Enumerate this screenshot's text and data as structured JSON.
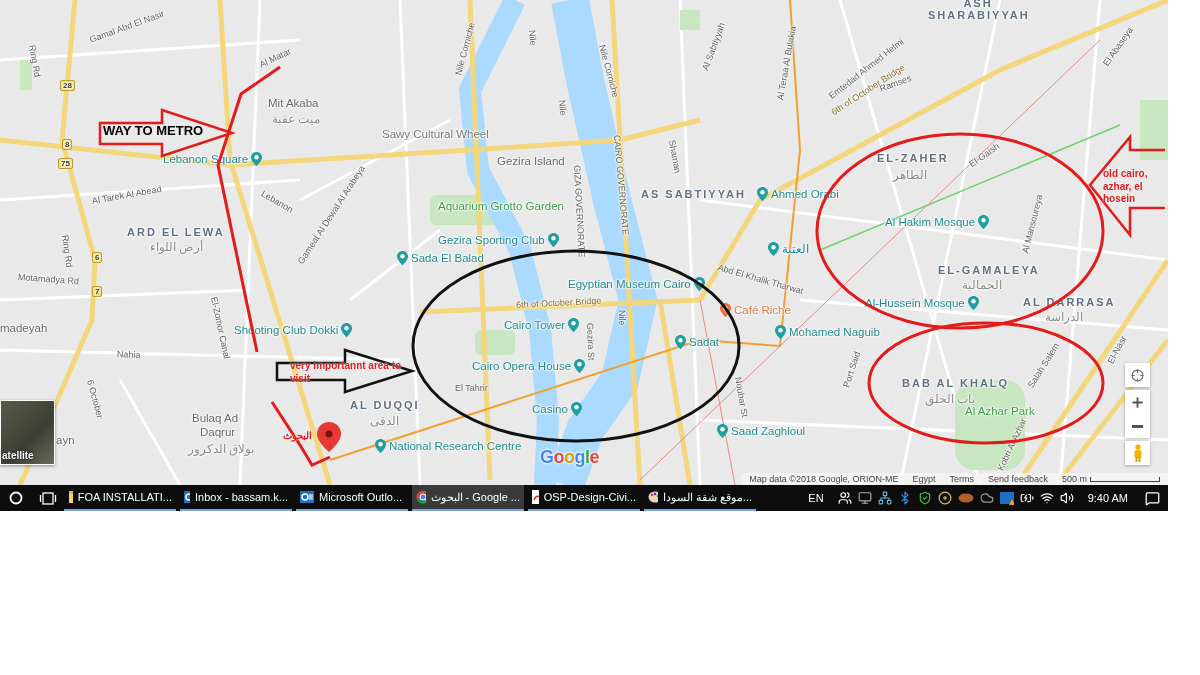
{
  "map": {
    "labels": [
      {
        "kind": "district",
        "text": "ASH SHARABIYYAH"
      },
      {
        "kind": "district",
        "text": "ARD EL LEWA"
      },
      {
        "kind": "district",
        "text": "AS SABTIYYAH"
      },
      {
        "kind": "district",
        "text": "EL-ZAHER"
      },
      {
        "kind": "district",
        "text": "EL-GAMALEYA"
      },
      {
        "kind": "district",
        "text": "AL DARRASA"
      },
      {
        "kind": "district",
        "text": "BAB AL KHALQ"
      },
      {
        "kind": "district",
        "text": "AL DUQQI"
      },
      {
        "kind": "arabic",
        "text": "أرض اللواء"
      },
      {
        "kind": "arabic",
        "text": "ميت عقبة"
      },
      {
        "kind": "arabic",
        "text": "الطاهر"
      },
      {
        "kind": "arabic",
        "text": "الجمالية"
      },
      {
        "kind": "arabic",
        "text": "الدراسة"
      },
      {
        "kind": "arabic",
        "text": "باب الخلق"
      },
      {
        "kind": "arabic",
        "text": "الدقى"
      },
      {
        "kind": "arabic",
        "text": "بولاق الدكرور"
      },
      {
        "kind": "place",
        "text": "Mit Akaba"
      },
      {
        "kind": "place",
        "text": "Gezira Island"
      },
      {
        "kind": "place",
        "text": "Bulaq Ad"
      },
      {
        "kind": "place",
        "text": "Daqrur"
      },
      {
        "kind": "place",
        "text": "madeyah"
      },
      {
        "kind": "place",
        "text": "ayn"
      },
      {
        "kind": "poi",
        "text": "Lebanon Square"
      },
      {
        "kind": "plain",
        "text": "Sawy Cultural Wheel"
      },
      {
        "kind": "park",
        "text": "Aquarium Grotto Garden"
      },
      {
        "kind": "poi",
        "text": "Gezira Sporting Club"
      },
      {
        "kind": "poi",
        "text": "Sada El Balad"
      },
      {
        "kind": "poi",
        "text": "Egyptian Museum Cairo"
      },
      {
        "kind": "poi",
        "text": "Cairo Tower"
      },
      {
        "kind": "poi",
        "text": "Cairo Opera House"
      },
      {
        "kind": "poi",
        "text": "Casino"
      },
      {
        "kind": "poi",
        "text": "Sadat"
      },
      {
        "kind": "cafe",
        "text": "Café Riche"
      },
      {
        "kind": "poi",
        "text": "Mohamed Naguib"
      },
      {
        "kind": "poi",
        "text": "Saad Zaghloul"
      },
      {
        "kind": "poi",
        "text": "Ahmed Orabi"
      },
      {
        "kind": "poi",
        "text": "العتبة"
      },
      {
        "kind": "poi",
        "text": "Al Hakim Mosque"
      },
      {
        "kind": "poi",
        "text": "Al-Hussein Mosque"
      },
      {
        "kind": "poi",
        "text": "Shooting Club Dokki"
      },
      {
        "kind": "poi",
        "text": "National Research Centre"
      },
      {
        "kind": "park",
        "text": "Al Azhar Park"
      },
      {
        "kind": "road",
        "text": "Nile Corniche"
      },
      {
        "kind": "road",
        "text": "Nile Corniche"
      },
      {
        "kind": "road",
        "text": "Nile"
      },
      {
        "kind": "road",
        "text": "Nile"
      },
      {
        "kind": "road",
        "text": "Nile"
      },
      {
        "kind": "bridge",
        "text": "6th of October Bridge"
      },
      {
        "kind": "bridge",
        "text": "6th of October Bridge"
      },
      {
        "kind": "road",
        "text": "El Tahrir"
      },
      {
        "kind": "road",
        "text": "Gezira St"
      },
      {
        "kind": "road",
        "text": "El-Zomor Canal"
      },
      {
        "kind": "road",
        "text": "Al Tarek Al Abead"
      },
      {
        "kind": "road",
        "text": "Motamadya Rd"
      },
      {
        "kind": "road",
        "text": "Nahia"
      },
      {
        "kind": "road",
        "text": "6 October"
      },
      {
        "kind": "road",
        "text": "Lebanon"
      },
      {
        "kind": "road",
        "text": "Gameat Al Dewal Al Arabeya"
      },
      {
        "kind": "road",
        "text": "Abd El Khalik Tharwat"
      },
      {
        "kind": "road",
        "text": "El-Gaish"
      },
      {
        "kind": "road",
        "text": "Ramses"
      },
      {
        "kind": "road",
        "text": "Salah Salem"
      },
      {
        "kind": "road",
        "text": "El-Nasr"
      },
      {
        "kind": "road",
        "text": "Port Said"
      },
      {
        "kind": "road",
        "text": "Noubar St"
      },
      {
        "kind": "road",
        "text": "Al Mansoureya"
      },
      {
        "kind": "road",
        "text": "Ring Rd"
      },
      {
        "kind": "road",
        "text": "Ring Rd"
      },
      {
        "kind": "road",
        "text": "Al Matar"
      },
      {
        "kind": "road",
        "text": "Gamal Abd El Nasir"
      },
      {
        "kind": "road",
        "text": "Al Teraa Al Bulakia"
      },
      {
        "kind": "road",
        "text": "Emtedad Ahmed Helmi"
      },
      {
        "kind": "road",
        "text": "Kobri Al Azhar"
      },
      {
        "kind": "road",
        "text": "Shaman"
      },
      {
        "kind": "road",
        "text": "Al Sabtiyyah"
      },
      {
        "kind": "road",
        "text": "El Abaseya"
      },
      {
        "kind": "road",
        "text": "CAIRO GOVERNORATE"
      },
      {
        "kind": "road",
        "text": "GIZA GOVERNORATE"
      },
      {
        "kind": "shield",
        "text": "28"
      },
      {
        "kind": "shield",
        "text": "8"
      },
      {
        "kind": "shield",
        "text": "75"
      },
      {
        "kind": "shield",
        "text": "6"
      },
      {
        "kind": "shield",
        "text": "7"
      }
    ],
    "satellite_toggle": "atellite",
    "logo": "Google",
    "attribution": [
      "Map data ©2018 Google, ORION-ME",
      "Egypt",
      "Terms",
      "Send feedback"
    ],
    "scale": "500 m"
  },
  "annotations": [
    {
      "kind": "heading",
      "text": "WAY TO METRO"
    },
    {
      "kind": "note",
      "text": "very importannt area to visit"
    },
    {
      "kind": "note",
      "text": "old cairo, azhar, el hosein"
    },
    {
      "kind": "note",
      "text": "البحوث"
    }
  ],
  "taskbar": {
    "items": [
      {
        "kind": "folder",
        "label": "FOA INSTALLATI...",
        "selected": false
      },
      {
        "kind": "mail",
        "label": "Inbox - bassam.k...",
        "selected": false
      },
      {
        "kind": "mail",
        "label": "Microsoft Outlo...",
        "selected": false
      },
      {
        "kind": "browser",
        "label": "البحوث - Google ...",
        "selected": true
      },
      {
        "kind": "pdf",
        "label": "OSP-Design-Civi...",
        "selected": false
      },
      {
        "kind": "paint",
        "label": "موقع شقة السودا...",
        "selected": false
      }
    ],
    "language": "EN",
    "time": "9:40 AM"
  }
}
